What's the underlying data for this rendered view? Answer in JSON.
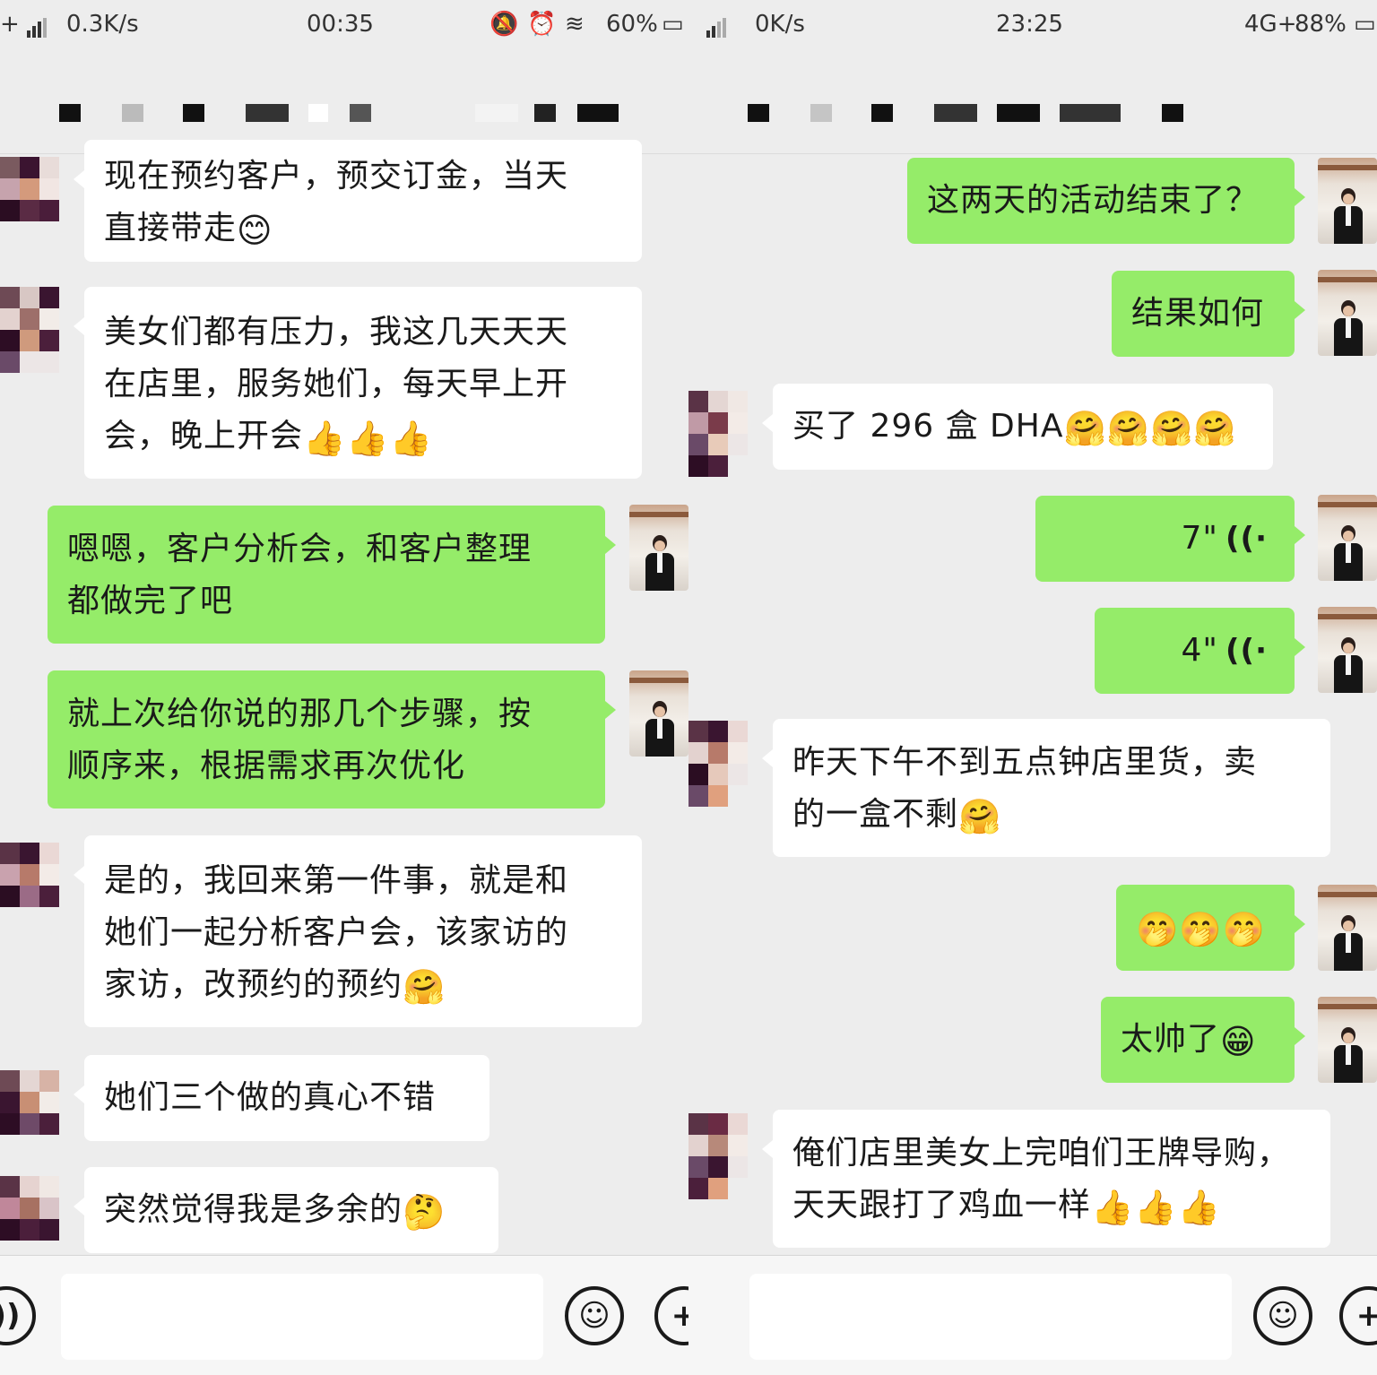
{
  "left": {
    "status": {
      "speed": "0.3K/s",
      "time": "00:35",
      "battery": "60%"
    },
    "messages": {
      "m1": "现在预约客户，预交订金，当天\n直接带走",
      "m1_emoji": "😊",
      "m2": "美女们都有压力，我这几天天天\n在店里，服务她们，每天早上开\n会，晚上开会",
      "m2_emoji": "👍👍👍",
      "m3": "嗯嗯，客户分析会，和客户整理\n都做完了吧",
      "m4": "就上次给你说的那几个步骤，按\n顺序来，根据需求再次优化",
      "m5": "是的，我回来第一件事，就是和\n她们一起分析客户会，该家访的\n家访，改预约的预约",
      "m5_emoji": "🤗",
      "m6": "她们三个做的真心不错",
      "m7": "突然觉得我是多余的",
      "m7_emoji": "🤔"
    }
  },
  "right": {
    "status": {
      "speed": "0K/s",
      "time": "23:25",
      "network": "4G+",
      "battery": "88%"
    },
    "messages": {
      "r1": "这两天的活动结束了？",
      "r2": "结果如何",
      "r3": "买了 296 盒 DHA",
      "r3_emoji": "🤗🤗🤗🤗",
      "r4_voice": "7\"",
      "r5_voice": "4\"",
      "r6": "昨天下午不到五点钟店里货，卖\n的一盒不剩",
      "r6_emoji": "🤗",
      "r7_emoji": "🤭🤭🤭",
      "r8": "太帅了",
      "r8_emoji": "😁",
      "r9": "俺们店里美女上完咱们王牌导购，\n天天跟打了鸡血一样",
      "r9_emoji": "👍👍👍"
    }
  },
  "icons": {
    "voice": "voice-input-icon",
    "emoji": "emoji-icon",
    "plus": "plus-icon",
    "voice_wave": "voice-wave-icon"
  },
  "colors": {
    "bubble_out": "#95ec69",
    "bubble_in": "#ffffff",
    "background": "#ededed"
  }
}
